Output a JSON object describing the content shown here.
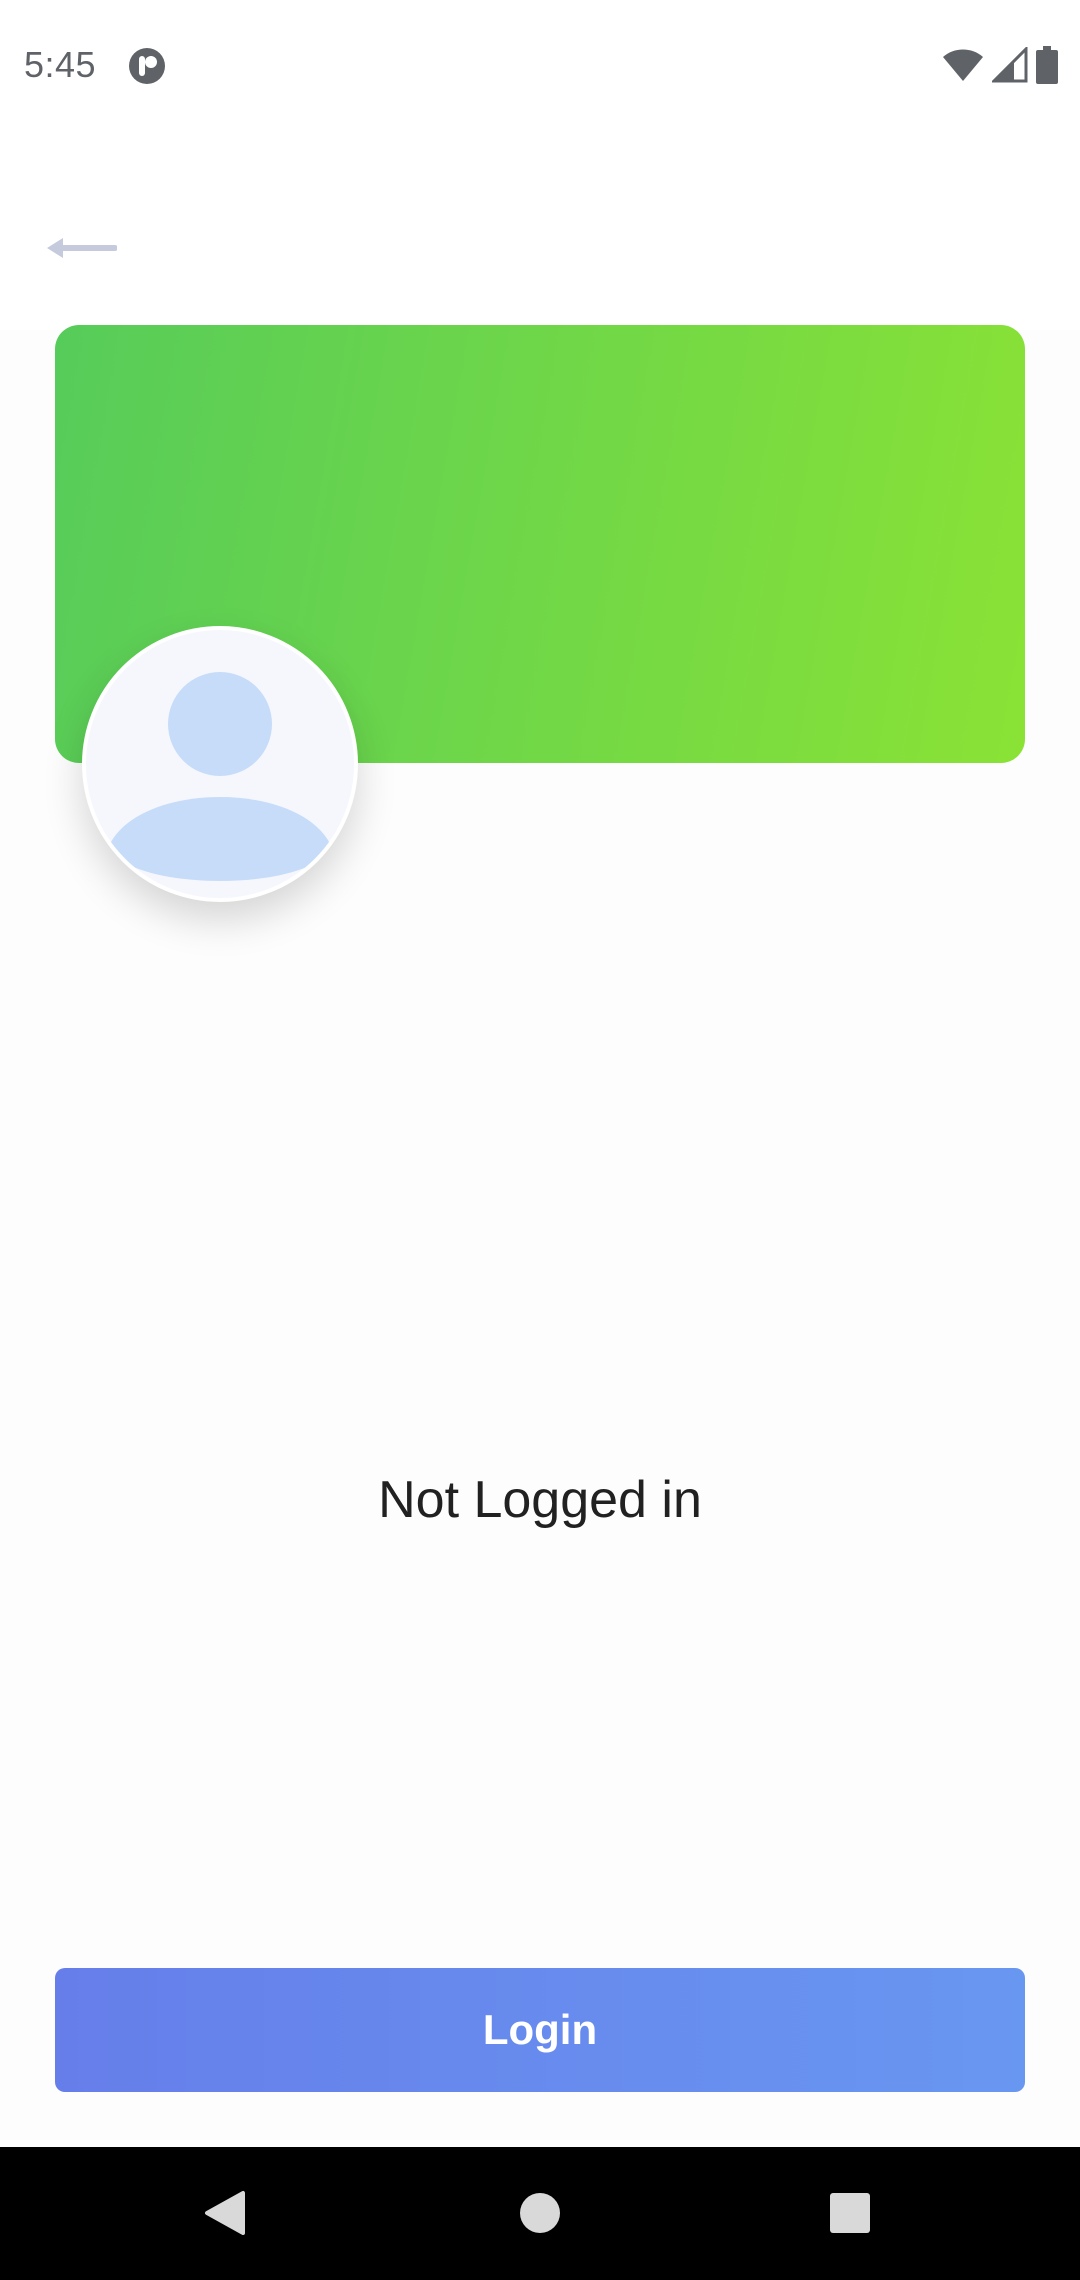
{
  "status_bar": {
    "time": "5:45",
    "icons": [
      "app-notification-icon",
      "wifi-icon",
      "cell-signal-icon",
      "battery-icon"
    ]
  },
  "toolbar": {
    "back_icon": "arrow-left-icon"
  },
  "profile": {
    "banner_colors": [
      "#56cc5a",
      "#8ae235"
    ],
    "avatar_icon": "person-placeholder-icon",
    "status_message": "Not Logged in"
  },
  "actions": {
    "login_label": "Login",
    "login_colors": [
      "#667eea",
      "#6897f1"
    ]
  },
  "nav_bar": {
    "buttons": [
      "back-triangle-icon",
      "home-circle-icon",
      "recents-square-icon"
    ]
  }
}
